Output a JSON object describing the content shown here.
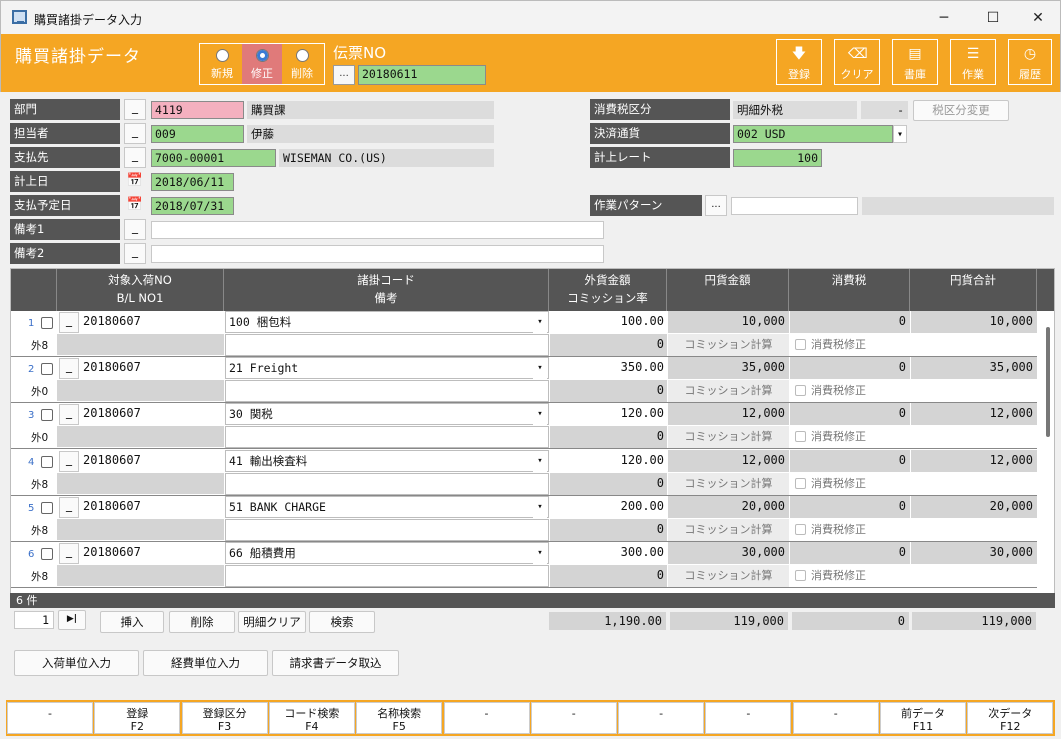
{
  "window": {
    "title": "購買諸掛データ入力",
    "minimize": "─",
    "maximize": "☐",
    "close": "✕"
  },
  "header": {
    "page_title": "購買諸掛データ",
    "modes": [
      {
        "label": "新規",
        "selected": false
      },
      {
        "label": "修正",
        "selected": true
      },
      {
        "label": "削除",
        "selected": false
      }
    ],
    "voucher_label": "伝票NO",
    "voucher_dot": "...",
    "voucher_no": "20180611",
    "toolbar": [
      {
        "label": "登録",
        "icon": "save-icon",
        "glyph": "🡇"
      },
      {
        "label": "クリア",
        "icon": "eraser-icon",
        "glyph": "⌫"
      },
      {
        "label": "書庫",
        "icon": "archive-icon",
        "glyph": "▤"
      },
      {
        "label": "作業",
        "icon": "task-icon",
        "glyph": "☰"
      },
      {
        "label": "履歴",
        "icon": "history-icon",
        "glyph": "◷"
      }
    ]
  },
  "form": {
    "dept": {
      "label": "部門",
      "btn": "_",
      "code": "4119",
      "name": "購買課"
    },
    "staff": {
      "label": "担当者",
      "btn": "_",
      "code": "009",
      "name": "伊藤"
    },
    "payee": {
      "label": "支払先",
      "btn": "_",
      "code": "7000-00001",
      "name": "WISEMAN CO.(US)"
    },
    "post_date": {
      "label": "計上日",
      "value": "2018/06/11"
    },
    "pay_date": {
      "label": "支払予定日",
      "value": "2018/07/31"
    },
    "note1": {
      "label": "備考1",
      "btn": "_"
    },
    "note2": {
      "label": "備考2",
      "btn": "_"
    },
    "tax_type": {
      "label": "消費税区分",
      "value": "明細外税",
      "dash": "-",
      "change_btn": "税区分変更"
    },
    "currency": {
      "label": "決済通貨",
      "value": "002 USD",
      "arrow": "▾"
    },
    "rate": {
      "label": "計上レート",
      "value": "100"
    },
    "work_pattern": {
      "label": "作業パターン",
      "dot": "..."
    }
  },
  "grid": {
    "headers": [
      {
        "top": "対象入荷NO",
        "bottom": "B/L NO1"
      },
      {
        "top": "諸掛コード",
        "bottom": "備考"
      },
      {
        "top": "外貨金額",
        "bottom": "コミッション率"
      },
      {
        "top": "円貨金額",
        "bottom": ""
      },
      {
        "top": "消費税",
        "bottom": ""
      },
      {
        "top": "円貨合計",
        "bottom": ""
      }
    ],
    "commission_btn": "コミッション計算",
    "tax_fix_label": "消費税修正",
    "row_btn": "_",
    "arrow": "▾",
    "rows": [
      {
        "num": "1",
        "receipt_no": "20180607",
        "code": "100 梱包料",
        "foreign": "100.00",
        "commission": "0",
        "yen": "10,000",
        "tax": "0",
        "total": "10,000",
        "sub": "外8"
      },
      {
        "num": "2",
        "receipt_no": "20180607",
        "code": "21 Freight",
        "foreign": "350.00",
        "commission": "0",
        "yen": "35,000",
        "tax": "0",
        "total": "35,000",
        "sub": "外0"
      },
      {
        "num": "3",
        "receipt_no": "20180607",
        "code": "30 関税",
        "foreign": "120.00",
        "commission": "0",
        "yen": "12,000",
        "tax": "0",
        "total": "12,000",
        "sub": "外0"
      },
      {
        "num": "4",
        "receipt_no": "20180607",
        "code": "41 輸出検査料",
        "foreign": "120.00",
        "commission": "0",
        "yen": "12,000",
        "tax": "0",
        "total": "12,000",
        "sub": "外8"
      },
      {
        "num": "5",
        "receipt_no": "20180607",
        "code": "51 BANK CHARGE",
        "foreign": "200.00",
        "commission": "0",
        "yen": "20,000",
        "tax": "0",
        "total": "20,000",
        "sub": "外8"
      },
      {
        "num": "6",
        "receipt_no": "20180607",
        "code": "66 船積費用",
        "foreign": "300.00",
        "commission": "0",
        "yen": "30,000",
        "tax": "0",
        "total": "30,000",
        "sub": "外8"
      }
    ]
  },
  "footer": {
    "count": "6 件",
    "page": "1",
    "last_btn": "▶|",
    "buttons": [
      "挿入",
      "削除",
      "明細クリア",
      "検索"
    ],
    "totals": {
      "foreign": "1,190.00",
      "yen": "119,000",
      "tax": "0",
      "total": "119,000"
    },
    "bottom_buttons": [
      "入荷単位入力",
      "経費単位入力",
      "請求書データ取込"
    ]
  },
  "fkeys": [
    {
      "label": "-",
      "key": ""
    },
    {
      "label": "登録",
      "key": "F2"
    },
    {
      "label": "登録区分",
      "key": "F3"
    },
    {
      "label": "コード検索",
      "key": "F4"
    },
    {
      "label": "名称検索",
      "key": "F5"
    },
    {
      "label": "-",
      "key": ""
    },
    {
      "label": "-",
      "key": ""
    },
    {
      "label": "-",
      "key": ""
    },
    {
      "label": "-",
      "key": ""
    },
    {
      "label": "-",
      "key": ""
    },
    {
      "label": "前データ",
      "key": "F11"
    },
    {
      "label": "次データ",
      "key": "F12"
    }
  ],
  "colors": {
    "accent": "#f5a623",
    "label_bg": "#555555",
    "input_green": "#9bd88e",
    "input_pink": "#f4b0bf",
    "mode_selected": "#e07a7a"
  }
}
